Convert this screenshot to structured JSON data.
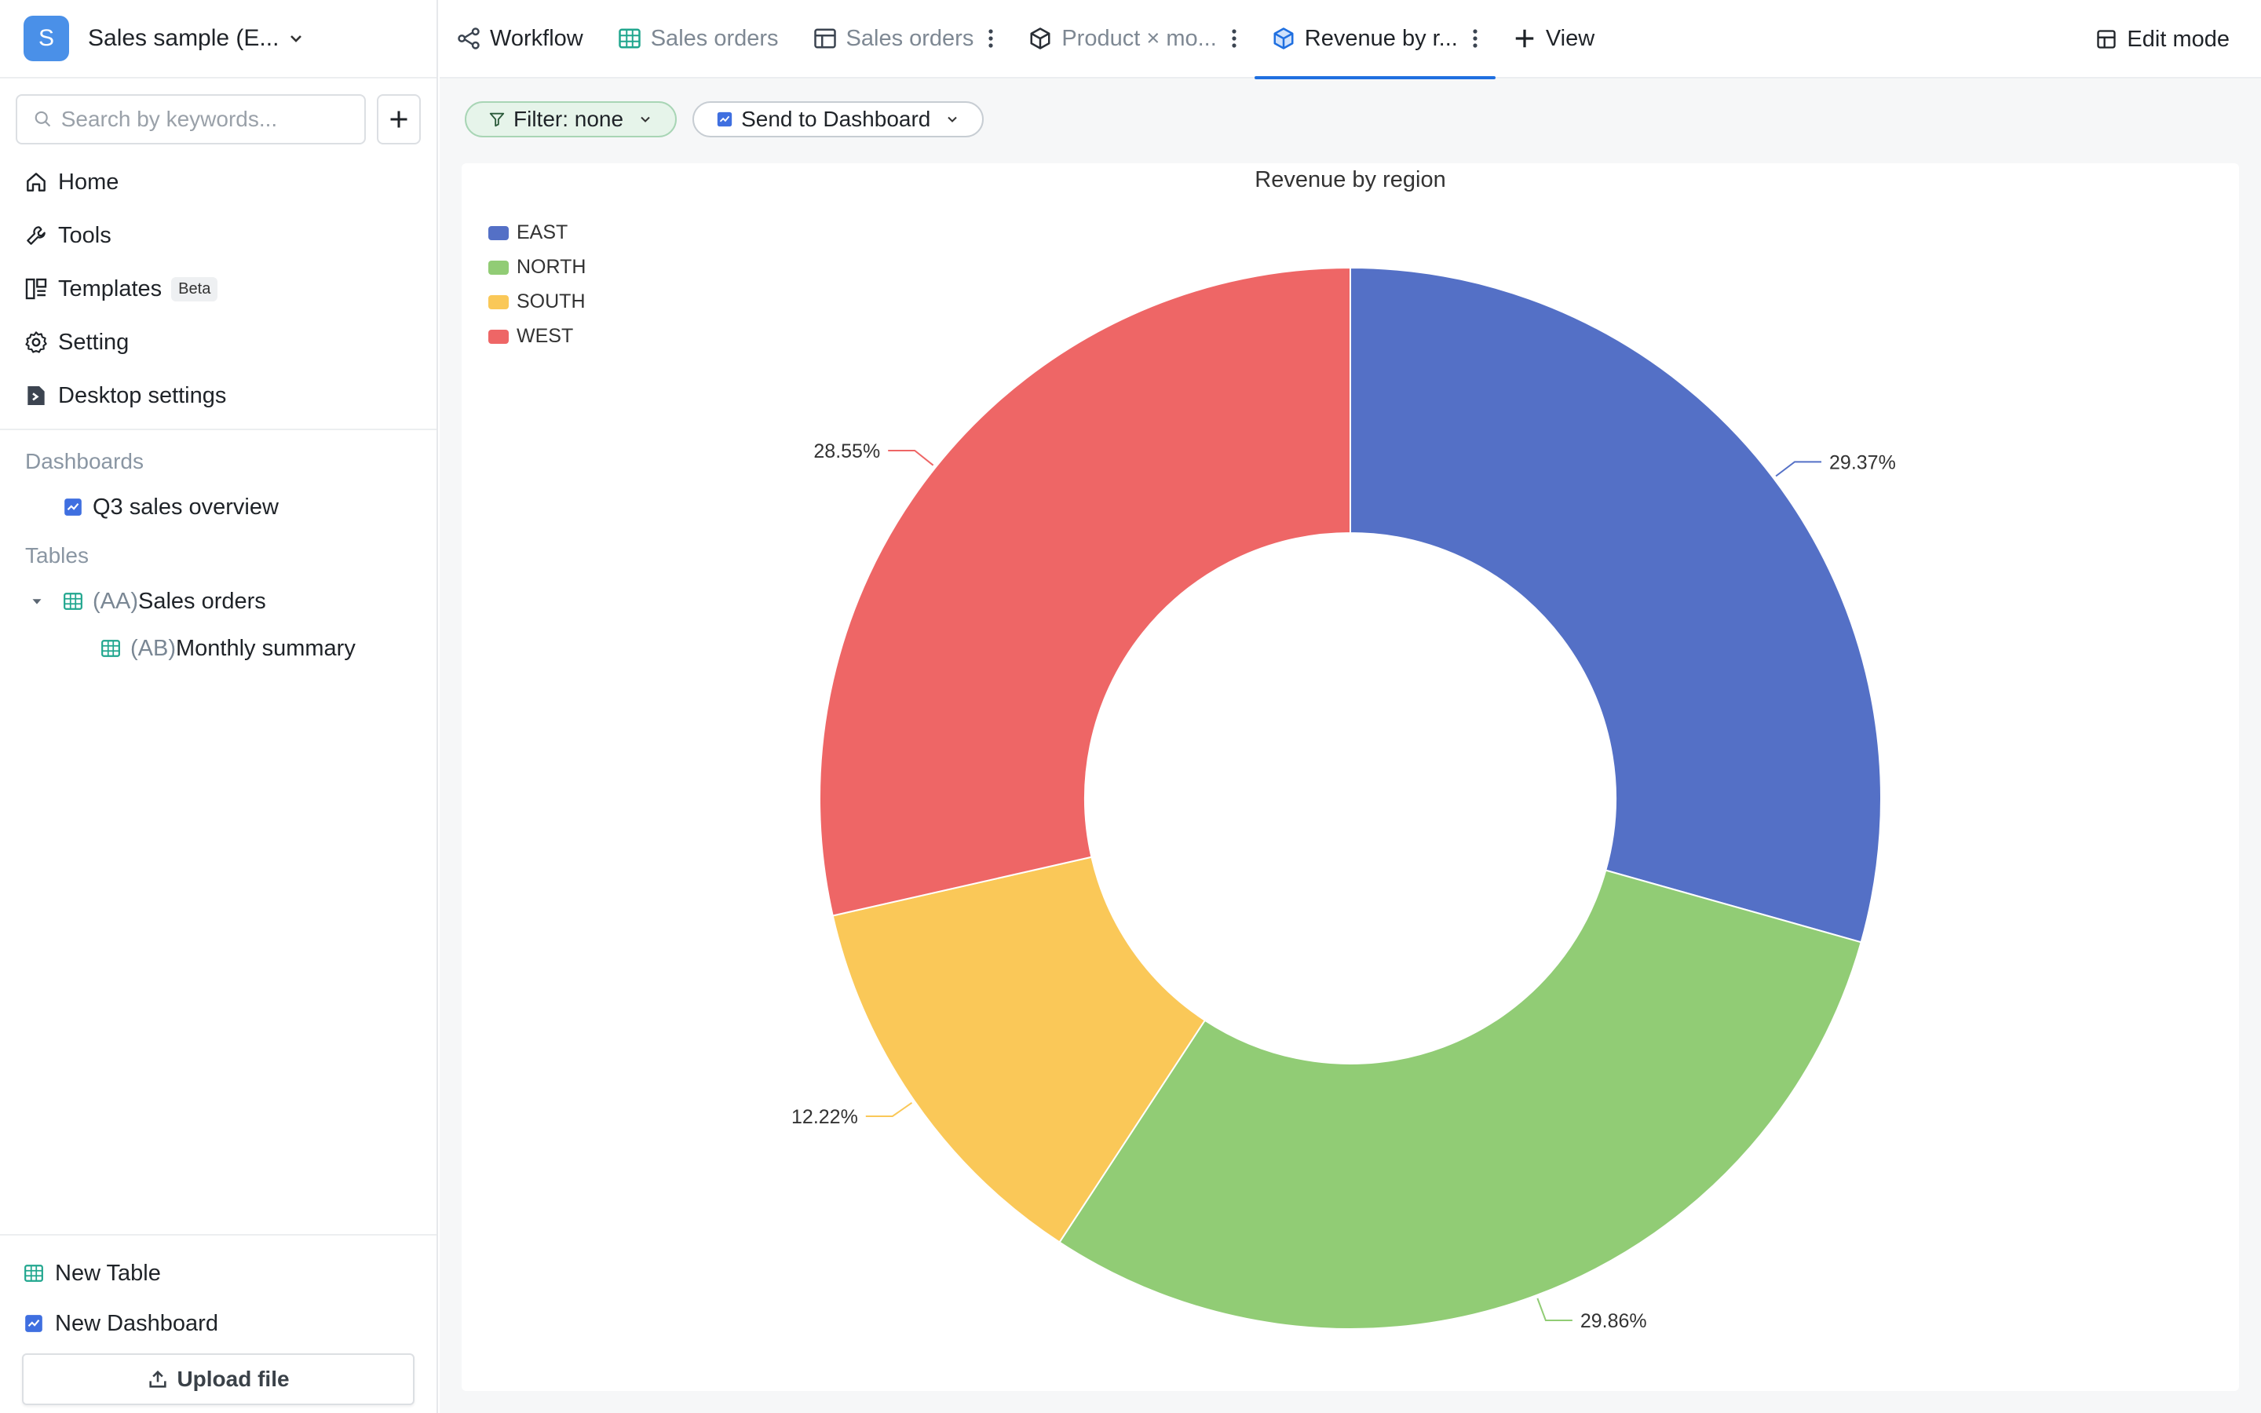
{
  "workspace": {
    "initial": "S",
    "name": "Sales sample (E..."
  },
  "search": {
    "placeholder": "Search by keywords..."
  },
  "nav": [
    {
      "label": "Home",
      "icon": "home-icon"
    },
    {
      "label": "Tools",
      "icon": "wrench-icon"
    },
    {
      "label": "Templates",
      "icon": "templates-icon",
      "badge": "Beta"
    },
    {
      "label": "Setting",
      "icon": "gear-icon"
    },
    {
      "label": "Desktop settings",
      "icon": "desktop-settings-icon"
    }
  ],
  "dashboards": {
    "title": "Dashboards",
    "items": [
      {
        "label": "Q3 sales overview"
      }
    ]
  },
  "tables": {
    "title": "Tables",
    "items": [
      {
        "prefix": "(AA)",
        "label": "Sales orders"
      },
      {
        "prefix": "(AB)",
        "label": "Monthly summary"
      }
    ]
  },
  "footer": {
    "new_table": "New Table",
    "new_dashboard": "New Dashboard",
    "upload": "Upload file"
  },
  "tabs": [
    {
      "label": "Workflow"
    },
    {
      "label": "Sales orders"
    },
    {
      "label": "Sales orders"
    },
    {
      "label": "Product × mo..."
    },
    {
      "label": "Revenue by r..."
    }
  ],
  "view_button": "View",
  "edit_mode": "Edit mode",
  "toolbar": {
    "filter": "Filter: none",
    "send": "Send to Dashboard"
  },
  "colors": {
    "accent": "#1f6fe0",
    "EAST": "#5470c6",
    "NORTH": "#91cc75",
    "SOUTH": "#fac858",
    "WEST": "#ee6666"
  },
  "chart_data": {
    "type": "pie",
    "title": "Revenue by region",
    "legend_position": "top-left",
    "categories": [
      "EAST",
      "NORTH",
      "SOUTH",
      "WEST"
    ],
    "values": [
      29.37,
      29.86,
      12.22,
      28.55
    ],
    "labels": [
      "29.37%",
      "29.86%",
      "12.22%",
      "28.55%"
    ],
    "donut": true
  }
}
